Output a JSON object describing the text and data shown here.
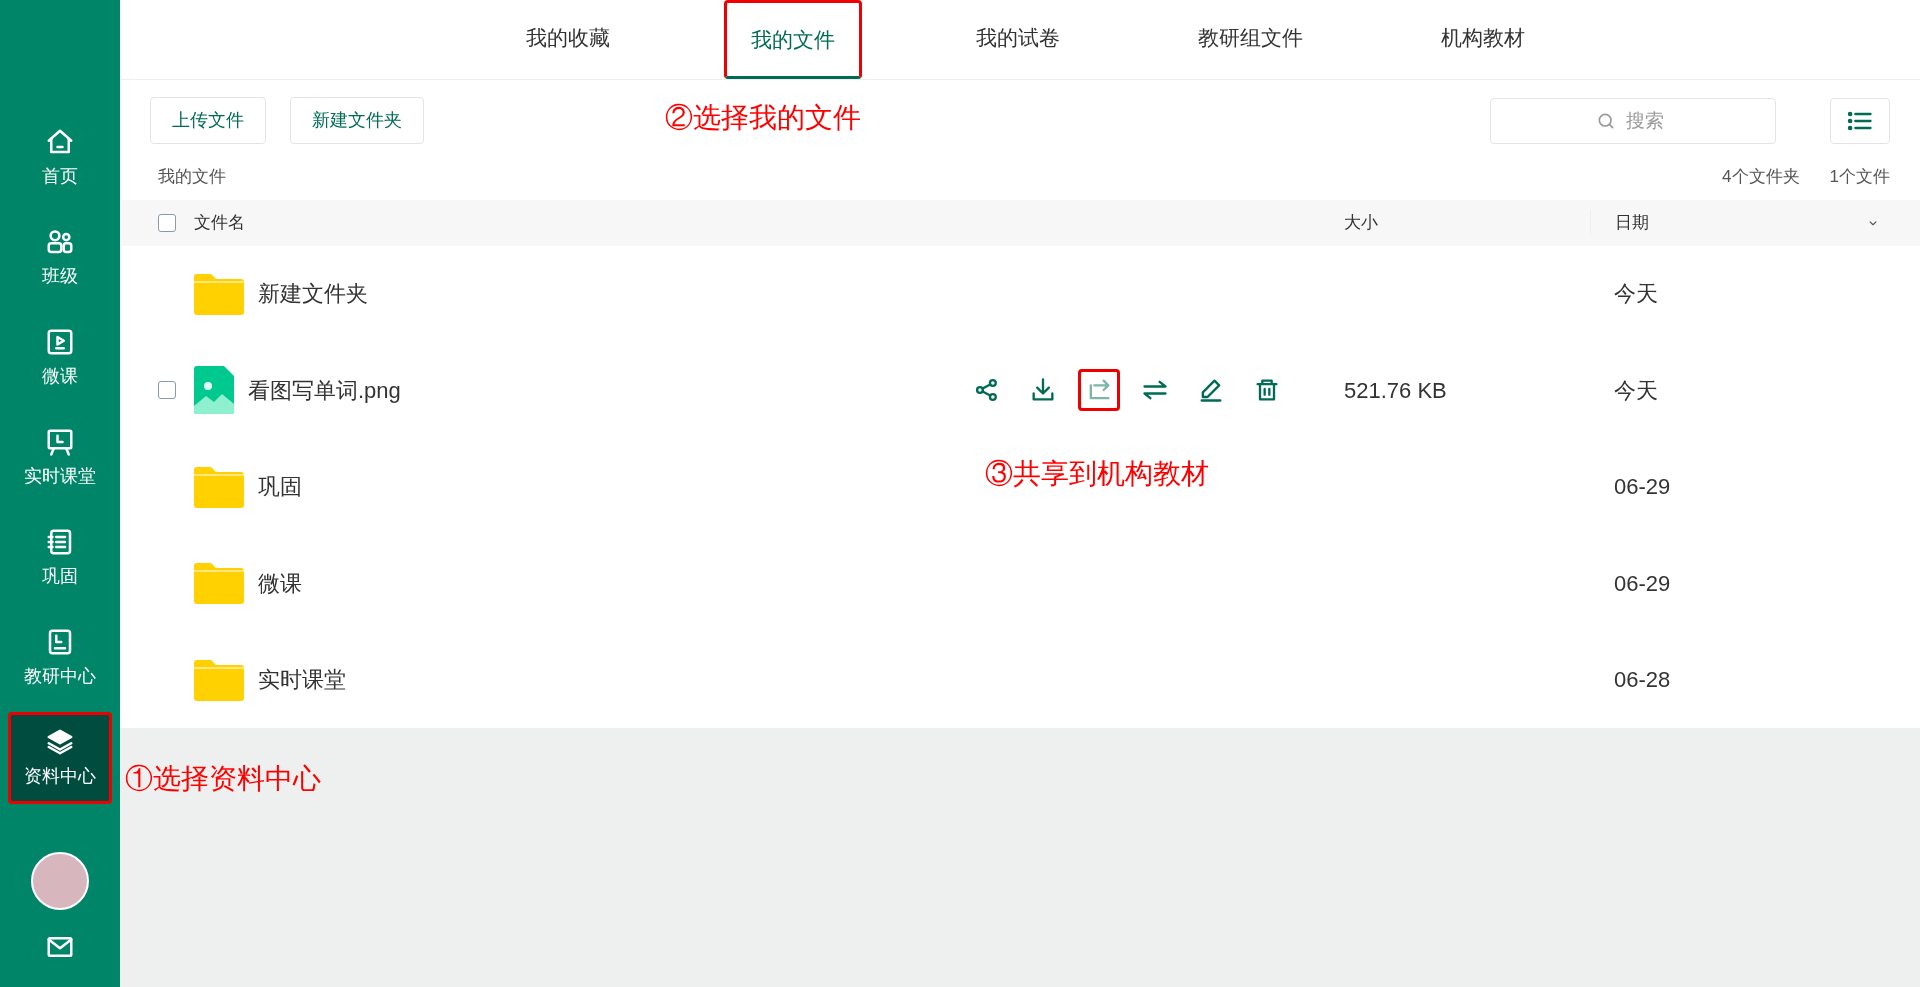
{
  "sidebar": {
    "items": [
      {
        "kind": "home",
        "label": "首页",
        "selected": false,
        "highlighted": false
      },
      {
        "kind": "people",
        "label": "班级",
        "selected": false,
        "highlighted": false
      },
      {
        "kind": "video",
        "label": "微课",
        "selected": false,
        "highlighted": false
      },
      {
        "kind": "board",
        "label": "实时课堂",
        "selected": false,
        "highlighted": false
      },
      {
        "kind": "notebook",
        "label": "巩固",
        "selected": false,
        "highlighted": false
      },
      {
        "kind": "book",
        "label": "教研中心",
        "selected": false,
        "highlighted": false
      },
      {
        "kind": "layers",
        "label": "资料中心",
        "selected": true,
        "highlighted": true
      }
    ]
  },
  "tabs": [
    {
      "label": "我的收藏",
      "selected": false,
      "highlighted": false
    },
    {
      "label": "我的文件",
      "selected": true,
      "highlighted": true
    },
    {
      "label": "我的试卷",
      "selected": false,
      "highlighted": false
    },
    {
      "label": "教研组文件",
      "selected": false,
      "highlighted": false
    },
    {
      "label": "机构教材",
      "selected": false,
      "highlighted": false
    }
  ],
  "toolbar": {
    "buttons": [
      "上传文件",
      "新建文件夹"
    ],
    "search": {
      "placeholder": "搜索"
    }
  },
  "breadcrumb": "我的文件",
  "counts": [
    "4个文件夹",
    "1个文件"
  ],
  "table": {
    "header_checked": false,
    "columns": [
      "文件名",
      "大小",
      "日期"
    ],
    "rows": [
      {
        "kind": "folder",
        "name": "新建文件夹",
        "date": "今天"
      },
      {
        "kind": "image",
        "name": "看图写单词.png",
        "size": "521.76 KB",
        "date": "今天",
        "checked": false,
        "actions": [
          {
            "kind": "share",
            "dimmed": false,
            "highlighted": false
          },
          {
            "kind": "download",
            "dimmed": false,
            "highlighted": false
          },
          {
            "kind": "forward",
            "dimmed": true,
            "highlighted": true
          },
          {
            "kind": "swap",
            "dimmed": false,
            "highlighted": false
          },
          {
            "kind": "edit",
            "dimmed": false,
            "highlighted": false
          },
          {
            "kind": "delete",
            "dimmed": false,
            "highlighted": false
          }
        ]
      },
      {
        "kind": "folder",
        "name": "巩固",
        "date": "06-29"
      },
      {
        "kind": "folder",
        "name": "微课",
        "date": "06-29"
      },
      {
        "kind": "folder",
        "name": "实时课堂",
        "date": "06-28"
      }
    ]
  },
  "annotations": [
    "①选择资料中心",
    "②选择我的文件",
    "③共享到机构教材"
  ]
}
